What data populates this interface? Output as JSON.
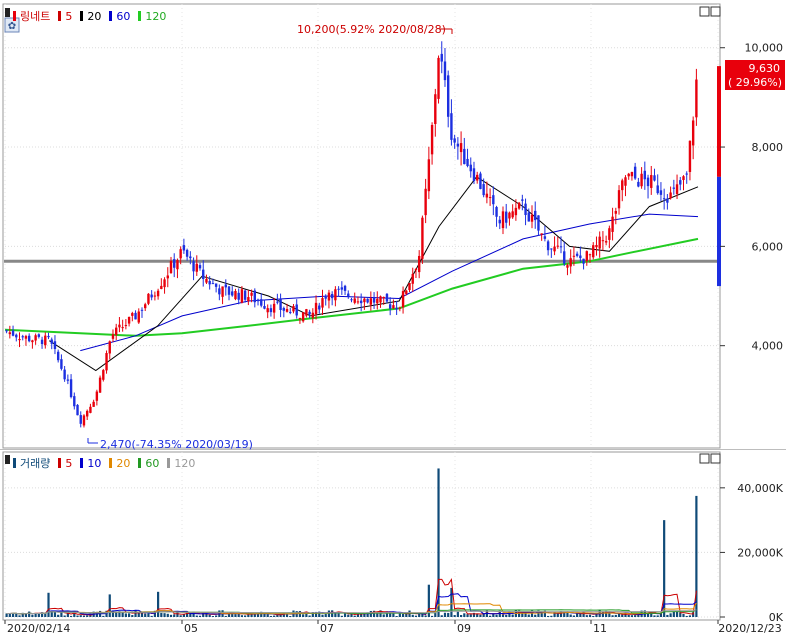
{
  "price_legend": {
    "name": "링네트",
    "ma": [
      {
        "label": "5",
        "color": "#cc0000"
      },
      {
        "label": "20",
        "color": "#000000"
      },
      {
        "label": "60",
        "color": "#0000cc"
      },
      {
        "label": "120",
        "color": "#22cc22"
      }
    ]
  },
  "volume_legend": {
    "name": "거래량",
    "ma": [
      {
        "label": "5",
        "color": "#cc0000"
      },
      {
        "label": "10",
        "color": "#0000cc"
      },
      {
        "label": "20",
        "color": "#e08800"
      },
      {
        "label": "60",
        "color": "#229922"
      },
      {
        "label": "120",
        "color": "#999999"
      }
    ]
  },
  "annotations": {
    "high": "10,200(5.92% 2020/08/28)",
    "low": "2,470(-74.35% 2020/03/19)",
    "current_price": "9,630",
    "current_change": "( 29.96%)"
  },
  "price_axis": {
    "ticks": [
      "10,000",
      "8,000",
      "6,000",
      "4,000"
    ]
  },
  "volume_axis": {
    "ticks": [
      "40,000K",
      "20,000K",
      "0K"
    ]
  },
  "date_axis": {
    "labels": [
      "2020/02/14",
      "05",
      "07",
      "09",
      "11",
      "2020/12/23"
    ]
  },
  "colors": {
    "up": "#e8000c",
    "down": "#1c2fe0",
    "volume_bar": "#0f4a78",
    "support_line": "#888888"
  },
  "chart_data": {
    "type": "candlestick",
    "title": "링네트",
    "x_start": "2020/02/14",
    "x_end": "2020/12/23",
    "ylim": [
      2000,
      10800
    ],
    "volume_ylim": [
      0,
      48000
    ],
    "support_level": 5700,
    "series_close": [
      [
        "2020/02/14",
        4300
      ],
      [
        "2020/02/24",
        4150
      ],
      [
        "2020/03/05",
        4100
      ],
      [
        "2020/03/12",
        3400
      ],
      [
        "2020/03/19",
        2470
      ],
      [
        "2020/03/26",
        3000
      ],
      [
        "2020/04/02",
        4200
      ],
      [
        "2020/04/13",
        4600
      ],
      [
        "2020/04/23",
        5200
      ],
      [
        "2020/05/04",
        5900
      ],
      [
        "2020/05/13",
        5400
      ],
      [
        "2020/05/22",
        5100
      ],
      [
        "2020/06/03",
        5000
      ],
      [
        "2020/06/12",
        4800
      ],
      [
        "2020/06/22",
        4700
      ],
      [
        "2020/07/01",
        4600
      ],
      [
        "2020/07/09",
        5100
      ],
      [
        "2020/07/20",
        5000
      ],
      [
        "2020/07/30",
        4900
      ],
      [
        "2020/08/10",
        4800
      ],
      [
        "2020/08/19",
        5800
      ],
      [
        "2020/08/24",
        7900
      ],
      [
        "2020/08/28",
        10000
      ],
      [
        "2020/09/03",
        8200
      ],
      [
        "2020/09/14",
        7400
      ],
      [
        "2020/09/24",
        6500
      ],
      [
        "2020/10/05",
        6800
      ],
      [
        "2020/10/15",
        6100
      ],
      [
        "2020/10/26",
        5700
      ],
      [
        "2020/11/04",
        5800
      ],
      [
        "2020/11/13",
        6300
      ],
      [
        "2020/11/20",
        7400
      ],
      [
        "2020/12/01",
        7300
      ],
      [
        "2020/12/11",
        7000
      ],
      [
        "2020/12/18",
        7400
      ],
      [
        "2020/12/23",
        9630
      ]
    ],
    "ma120": [
      [
        "2020/02/14",
        4320
      ],
      [
        "2020/03/19",
        4250
      ],
      [
        "2020/04/13",
        4200
      ],
      [
        "2020/05/04",
        4250
      ],
      [
        "2020/06/03",
        4400
      ],
      [
        "2020/07/01",
        4550
      ],
      [
        "2020/08/10",
        4750
      ],
      [
        "2020/09/03",
        5150
      ],
      [
        "2020/10/05",
        5550
      ],
      [
        "2020/11/04",
        5700
      ],
      [
        "2020/11/20",
        5850
      ],
      [
        "2020/12/23",
        6150
      ]
    ],
    "ma60": [
      [
        "2020/03/19",
        3900
      ],
      [
        "2020/04/13",
        4200
      ],
      [
        "2020/05/04",
        4600
      ],
      [
        "2020/06/03",
        4900
      ],
      [
        "2020/07/09",
        5000
      ],
      [
        "2020/08/10",
        4950
      ],
      [
        "2020/09/03",
        5500
      ],
      [
        "2020/10/05",
        6150
      ],
      [
        "2020/11/04",
        6450
      ],
      [
        "2020/12/01",
        6650
      ],
      [
        "2020/12/23",
        6600
      ]
    ],
    "ma20": [
      [
        "2020/03/05",
        4100
      ],
      [
        "2020/03/26",
        3500
      ],
      [
        "2020/04/23",
        4400
      ],
      [
        "2020/05/13",
        5400
      ],
      [
        "2020/06/12",
        5000
      ],
      [
        "2020/07/01",
        4600
      ],
      [
        "2020/08/10",
        4900
      ],
      [
        "2020/08/28",
        6400
      ],
      [
        "2020/09/14",
        7400
      ],
      [
        "2020/10/05",
        6800
      ],
      [
        "2020/10/26",
        6000
      ],
      [
        "2020/11/13",
        5900
      ],
      [
        "2020/12/01",
        6800
      ],
      [
        "2020/12/23",
        7200
      ]
    ],
    "volume_spikes_k": [
      [
        "2020/03/05",
        7500
      ],
      [
        "2020/04/02",
        7000
      ],
      [
        "2020/04/23",
        7800
      ],
      [
        "2020/08/24",
        10000
      ],
      [
        "2020/08/28",
        46000
      ],
      [
        "2020/09/03",
        9000
      ],
      [
        "2020/12/07",
        30000
      ],
      [
        "2020/12/23",
        37500
      ]
    ]
  }
}
